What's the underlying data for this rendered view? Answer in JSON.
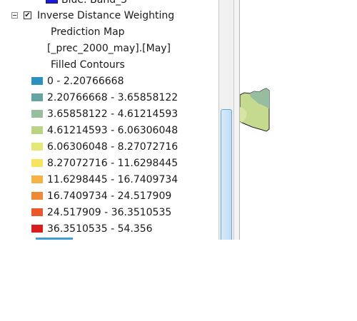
{
  "toc": {
    "prev_layer": {
      "band_label": "Blue:   Band_3",
      "swatch_color": "#1a1ad8"
    },
    "layer": {
      "name": "Inverse Distance Weighting",
      "checked": true,
      "check_glyph": "✔",
      "expander_icon": "collapse-minus-icon",
      "checkbox_icon": "checkbox-checked-icon"
    },
    "symbology_heading_1": "Prediction Map",
    "symbology_heading_2": "[_prec_2000_may].[May]",
    "symbology_heading_3": "Filled Contours",
    "legend_items": [
      {
        "label": "0 - 2.20766668",
        "color": "#2f8fbf"
      },
      {
        "label": "2.20766668 - 3.65858122",
        "color": "#67a3a3"
      },
      {
        "label": "3.65858122 - 4.61214593",
        "color": "#98be9b"
      },
      {
        "label": "4.61214593 - 6.06306048",
        "color": "#bad384"
      },
      {
        "label": "6.06306048 - 8.27072716",
        "color": "#e4e876"
      },
      {
        "label": "8.27072716 - 11.6298445",
        "color": "#f8e35c"
      },
      {
        "label": "11.6298445 - 16.7409734",
        "color": "#f6b345"
      },
      {
        "label": "16.7409734 - 24.517909",
        "color": "#ef8935"
      },
      {
        "label": "24.517909 - 36.3510535",
        "color": "#e9592a"
      },
      {
        "label": "36.3510535 - 54.356",
        "color": "#d91d1d"
      }
    ]
  },
  "map": {
    "polygon_colors": [
      "#c5d98f",
      "#96bda0",
      "#d8e4a5"
    ]
  }
}
